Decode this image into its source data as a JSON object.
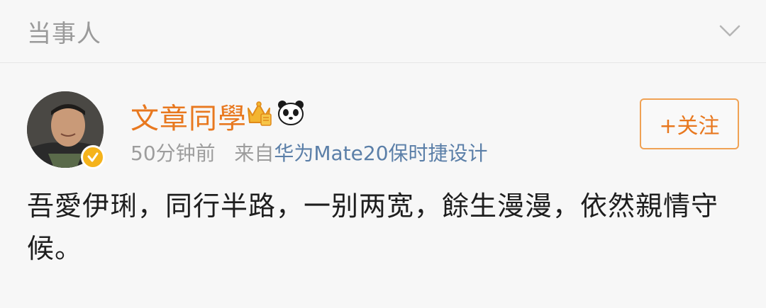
{
  "header": {
    "title": "当事人"
  },
  "post": {
    "username": "文章同學",
    "time": "50分钟前",
    "source_prefix": "来自",
    "device": "华为Mate20保时捷设计",
    "follow_label": "+关注",
    "text": "吾愛伊琍，同行半路，一别两宽，餘生漫漫，依然親情守候。",
    "badges": [
      "crown-member-icon",
      "panda-icon"
    ]
  },
  "colors": {
    "accent_orange": "#e8781f",
    "link_blue": "#5b7fa8",
    "verified_gold": "#f5b31b"
  }
}
